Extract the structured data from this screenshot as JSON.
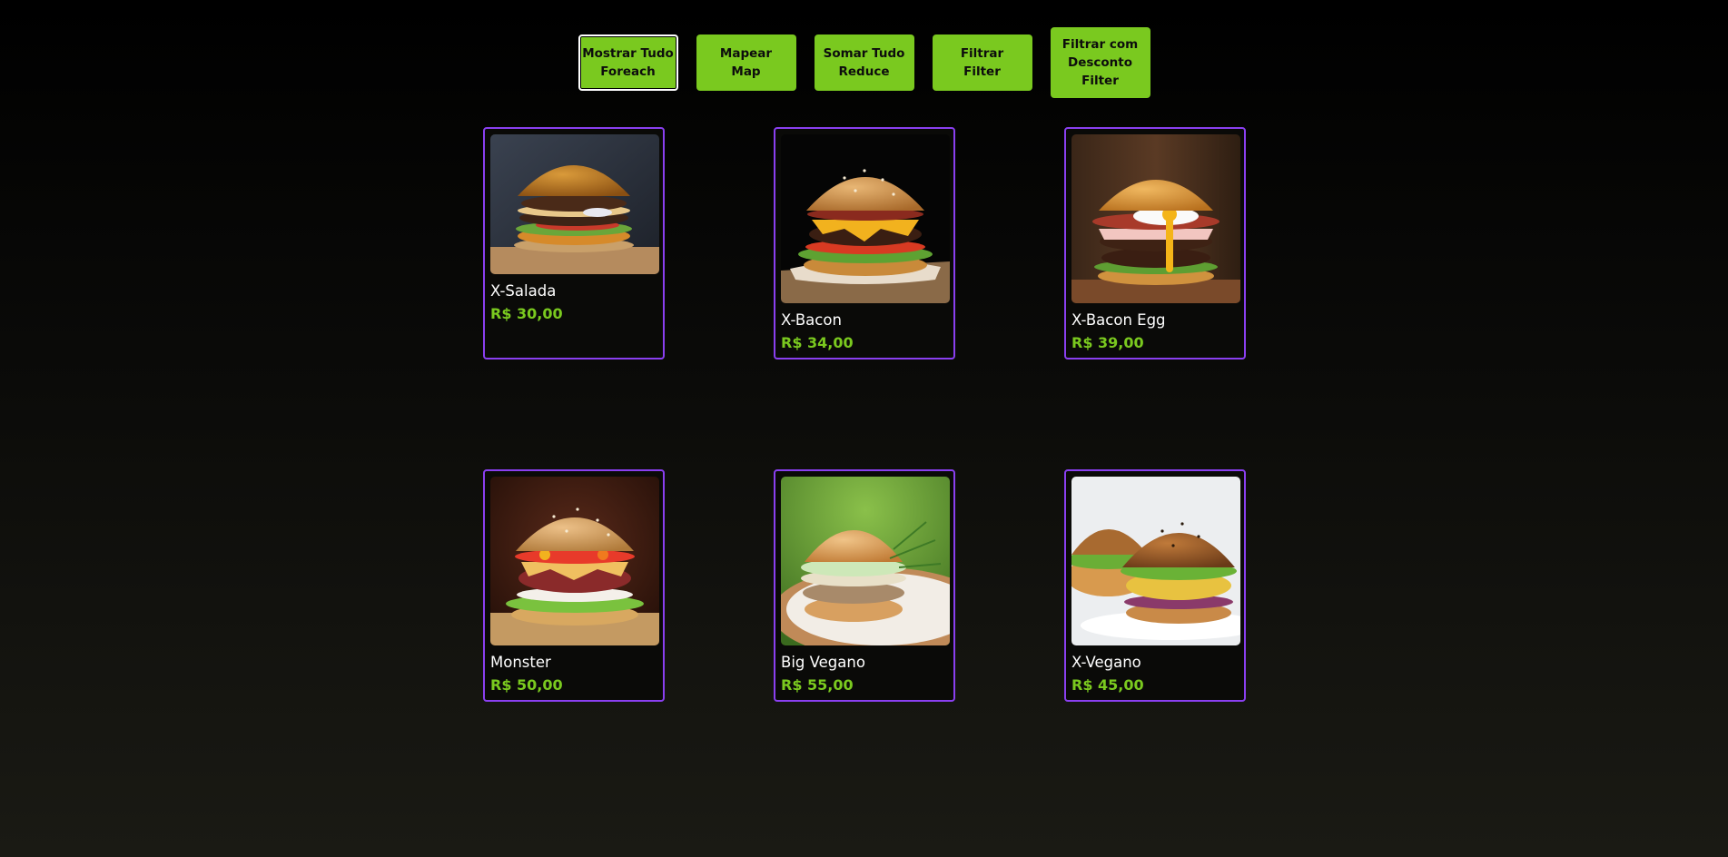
{
  "buttons": [
    {
      "line1": "Mostrar Tudo",
      "line2": "Foreach"
    },
    {
      "line1": "Mapear",
      "line2": "Map"
    },
    {
      "line1": "Somar Tudo",
      "line2": "Reduce"
    },
    {
      "line1": "Filtrar",
      "line2": "Filter"
    },
    {
      "line1": "Filtrar com",
      "line2": "Desconto",
      "line3": "Filter"
    }
  ],
  "products": [
    {
      "name": "X-Salada",
      "price": "R$ 30,00"
    },
    {
      "name": "X-Bacon",
      "price": "R$ 34,00"
    },
    {
      "name": "X-Bacon Egg",
      "price": "R$ 39,00"
    },
    {
      "name": "Monster",
      "price": "R$ 50,00"
    },
    {
      "name": "Big Vegano",
      "price": "R$ 55,00"
    },
    {
      "name": "X-Vegano",
      "price": "R$ 45,00"
    }
  ],
  "colors": {
    "accent": "#7ac91f",
    "card_border": "#8a3ff0",
    "background": "#000000"
  }
}
